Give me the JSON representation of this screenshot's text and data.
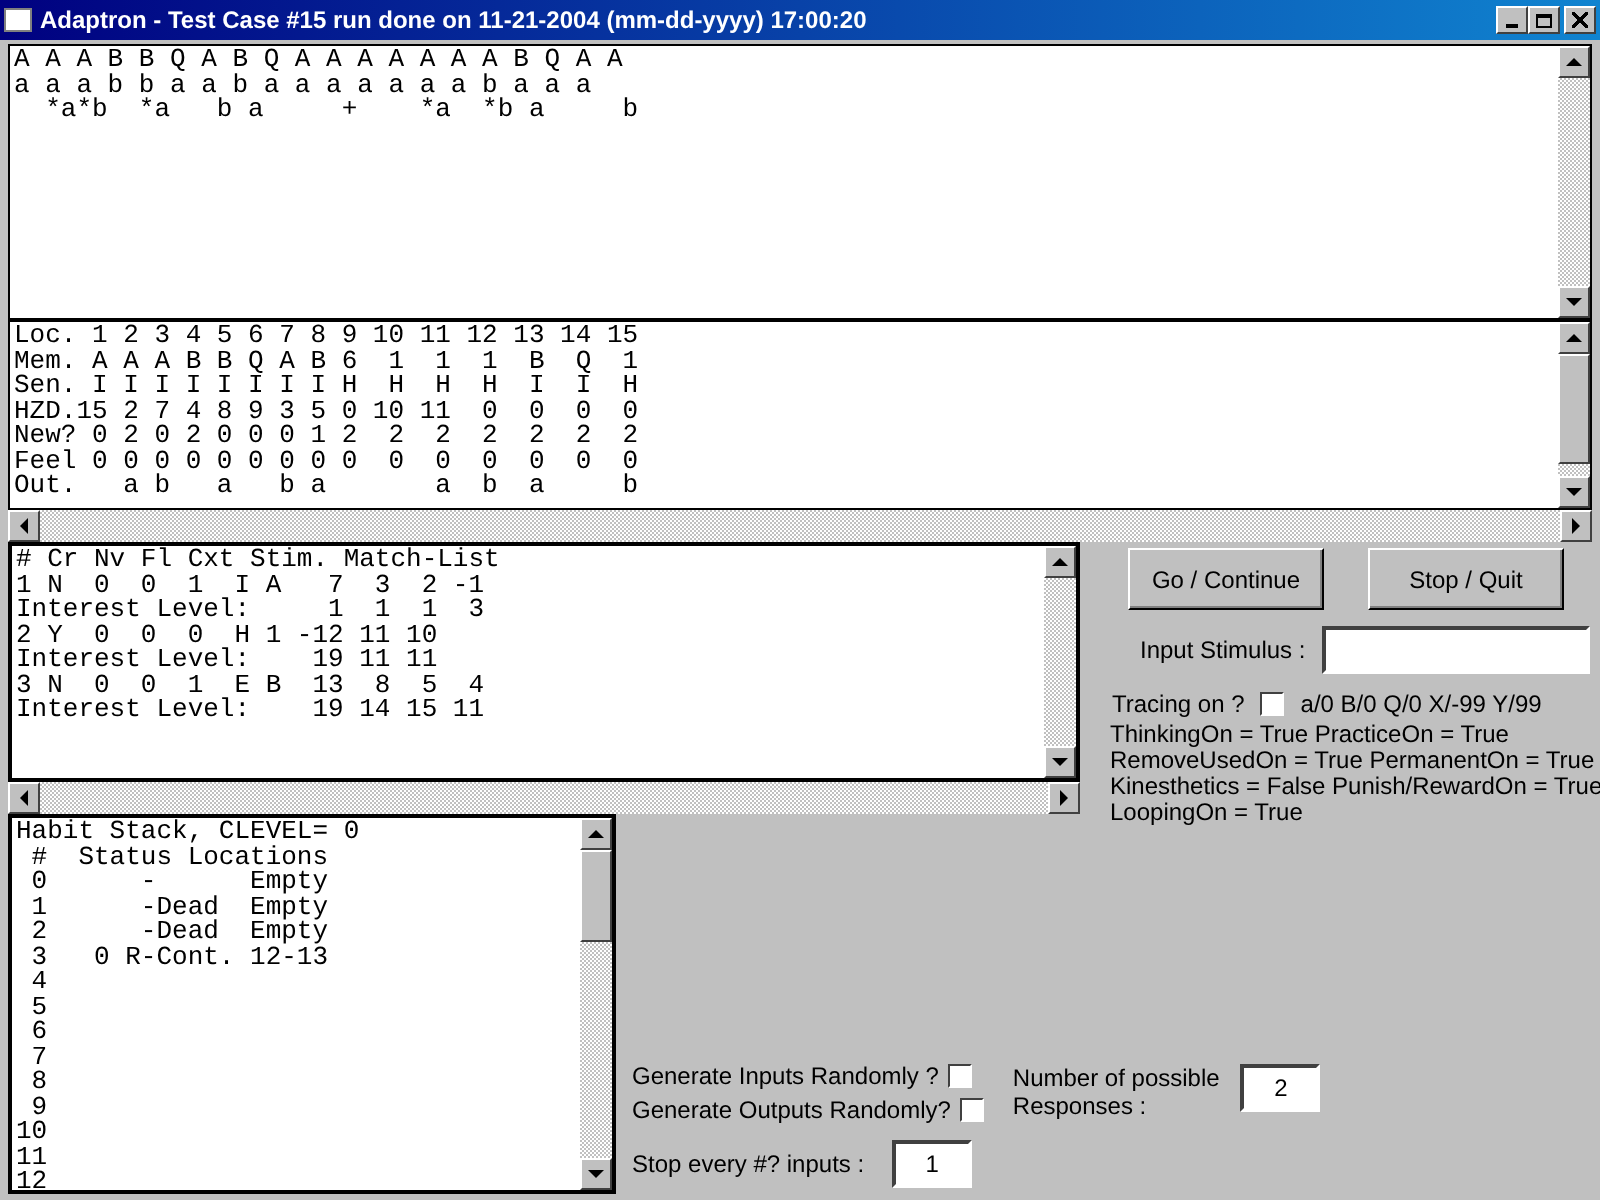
{
  "window": {
    "title": "Adaptron - Test Case #15 run done on 11-21-2004 (mm-dd-yyyy) 17:00:20"
  },
  "sequence_pane": {
    "lines": [
      "A A A B B Q A B Q A A A A A A A B Q A A",
      "a a a b b a a b a a a a a a a b a a a",
      "  *a*b  *a   b a     +    *a  *b a     b"
    ]
  },
  "memory_pane": {
    "lines": [
      "Loc. 1 2 3 4 5 6 7 8 9 10 11 12 13 14 15",
      "Mem. A A A B B Q A B 6  1  1  1  B  Q  1",
      "Sen. I I I I I I I I H  H  H  H  I  I  H",
      "HZD.15 2 7 4 8 9 3 5 0 10 11  0  0  0  0",
      "New? 0 2 0 2 0 0 0 1 2  2  2  2  2  2  2",
      "Feel 0 0 0 0 0 0 0 0 0  0  0  0  0  0  0",
      "Out.   a b   a   b a       a  b  a     b"
    ]
  },
  "match_pane": {
    "lines": [
      "# Cr Nv Fl Cxt Stim. Match-List",
      "1 N  0  0  1  I A   7  3  2 -1",
      "Interest Level:     1  1  1  3",
      "2 Y  0  0  0  H 1 -12 11 10",
      "Interest Level:    19 11 11",
      "3 N  0  0  1  E B  13  8  5  4",
      "Interest Level:    19 14 15 11"
    ]
  },
  "habit_pane": {
    "lines": [
      "Habit Stack, CLEVEL= 0",
      " #  Status Locations",
      " 0      -      Empty",
      " 1      -Dead  Empty",
      " 2      -Dead  Empty",
      " 3   0 R-Cont. 12-13",
      " 4",
      " 5",
      " 6",
      " 7",
      " 8",
      " 9",
      "10",
      "11",
      "12"
    ]
  },
  "controls": {
    "buttons": [
      "Go / Continue",
      "Stop / Quit"
    ],
    "input_label": "Input Stimulus :",
    "tracing": {
      "label": "Tracing on ?",
      "checked": false,
      "legend": "a/0  B/0  Q/0  X/-99  Y/99"
    },
    "settings": [
      "ThinkingOn = True PracticeOn = True",
      "RemoveUsedOn = True PermanentOn = True",
      "Kinesthetics = False Punish/RewardOn = True",
      "LoopingOn = True"
    ]
  },
  "generate": {
    "inputs": {
      "label": "Generate Inputs Randomly ?",
      "checked": false
    },
    "outputs": {
      "label": "Generate Outputs Randomly?",
      "checked": false
    },
    "stop_every": {
      "label": "Stop every #? inputs :",
      "value": "1"
    },
    "responses": {
      "label": "Number of possible Responses :",
      "value": "2"
    }
  }
}
